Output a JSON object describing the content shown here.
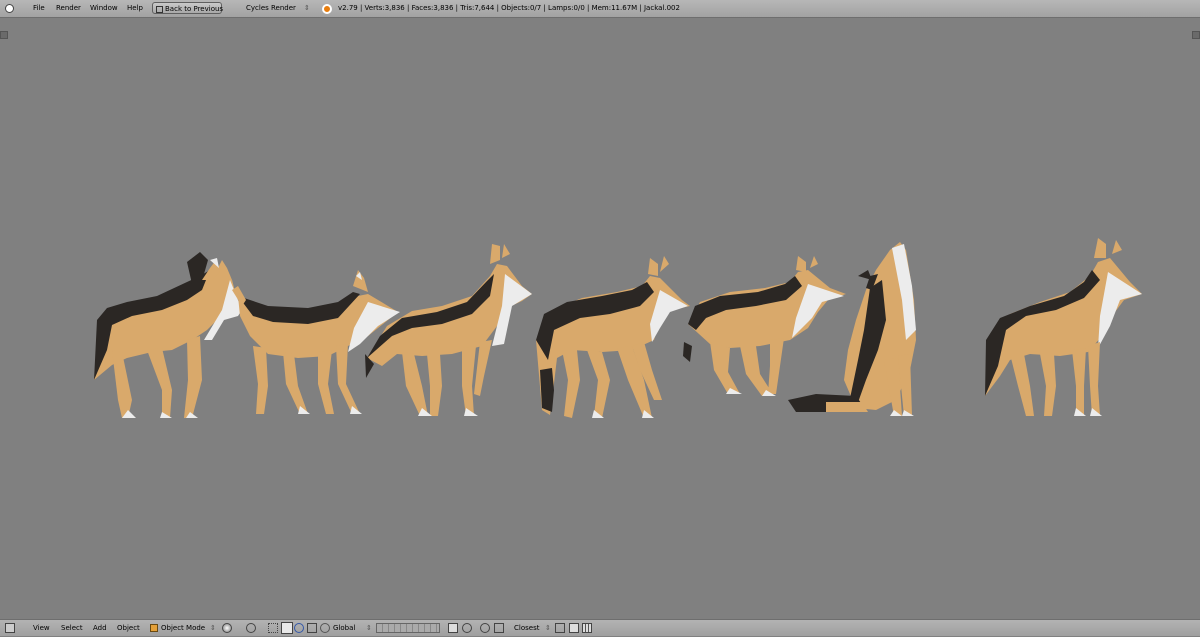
{
  "topbar": {
    "menu": [
      "File",
      "Render",
      "Window",
      "Help"
    ],
    "back_button": "Back to Previous",
    "render_engine": "Cycles Render",
    "stats": "v2.79 | Verts:3,836 | Faces:3,836 | Tris:7,644 | Objects:0/7 | Lamps:0/0 | Mem:11.67M | Jackal.002"
  },
  "bottombar": {
    "menu": [
      "View",
      "Select",
      "Add",
      "Object"
    ],
    "mode": "Object Mode",
    "orientation": "Global",
    "snap_target": "Closest"
  },
  "colors": {
    "fur_tan": "#d9a96b",
    "fur_dark": "#2b2724",
    "fur_white": "#ececec",
    "viewport_bg": "#808080"
  }
}
